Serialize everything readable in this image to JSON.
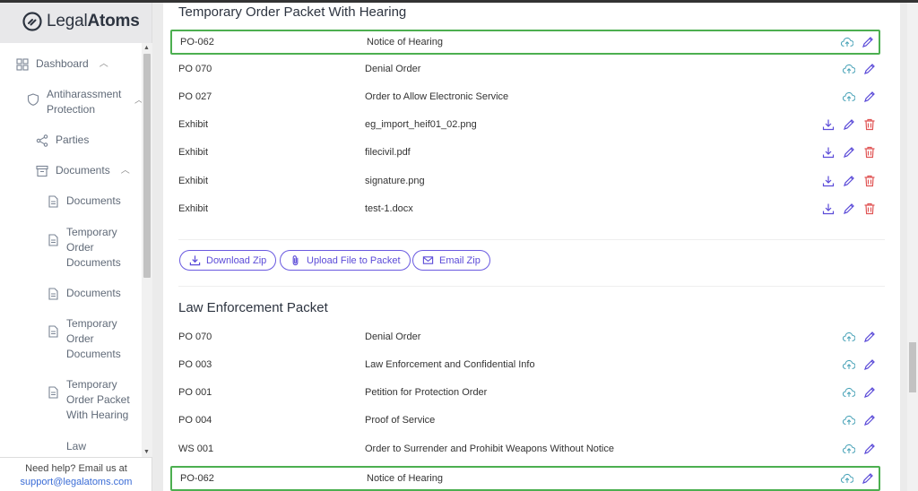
{
  "brand": {
    "name_light": "Legal",
    "name_bold": "Atoms"
  },
  "sidebar": {
    "items": [
      {
        "label": "Dashboard",
        "icon": "grid-icon"
      },
      {
        "label": "Antiharassment Protection",
        "icon": "shield-icon"
      },
      {
        "label": "Parties",
        "icon": "share-icon"
      },
      {
        "label": "Documents",
        "icon": "archive-icon"
      },
      {
        "label": "Documents",
        "icon": "file-icon"
      },
      {
        "label": "Temporary Order Documents",
        "icon": "file-icon"
      },
      {
        "label": "Documents",
        "icon": "file-icon"
      },
      {
        "label": "Temporary Order Documents",
        "icon": "file-icon"
      },
      {
        "label": "Temporary Order Packet With Hearing",
        "icon": "file-icon"
      },
      {
        "label": "Law",
        "icon": "file-icon"
      }
    ],
    "help_text": "Need help? Email us at",
    "help_email": "support@legalatoms.com"
  },
  "packet1": {
    "title": "Temporary Order Packet With Hearing",
    "rows": [
      {
        "code": "PO-062",
        "name": "Notice of Hearing",
        "actions": [
          "upload-cloud-icon",
          "edit-pencil-icon"
        ]
      },
      {
        "code": "PO 070",
        "name": "Denial Order",
        "actions": [
          "upload-cloud-icon",
          "edit-pencil-icon"
        ]
      },
      {
        "code": "PO 027",
        "name": "Order to Allow Electronic Service",
        "actions": [
          "upload-cloud-icon",
          "edit-pencil-icon"
        ]
      },
      {
        "code": "Exhibit",
        "name": "eg_import_heif01_02.png",
        "actions": [
          "download-icon",
          "edit-pencil-icon",
          "trash-icon"
        ]
      },
      {
        "code": "Exhibit",
        "name": "filecivil.pdf",
        "actions": [
          "download-icon",
          "edit-pencil-icon",
          "trash-icon"
        ]
      },
      {
        "code": "Exhibit",
        "name": "signature.png",
        "actions": [
          "download-icon",
          "edit-pencil-icon",
          "trash-icon"
        ]
      },
      {
        "code": "Exhibit",
        "name": "test-1.docx",
        "actions": [
          "download-icon",
          "edit-pencil-icon",
          "trash-icon"
        ]
      }
    ],
    "buttons": {
      "download_zip": "Download Zip",
      "upload_file": "Upload File to Packet",
      "email_zip": "Email Zip"
    }
  },
  "packet2": {
    "title": "Law Enforcement Packet",
    "rows": [
      {
        "code": "PO 070",
        "name": "Denial Order"
      },
      {
        "code": "PO 003",
        "name": "Law Enforcement and Confidential Info"
      },
      {
        "code": "PO 001",
        "name": "Petition for Protection Order"
      },
      {
        "code": "PO 004",
        "name": "Proof of Service"
      },
      {
        "code": "WS 001",
        "name": "Order to Surrender and Prohibit Weapons Without Notice"
      },
      {
        "code": "PO-062",
        "name": "Notice of Hearing"
      }
    ]
  },
  "colors": {
    "accent": "#5b4bd8",
    "upload": "#4aa3b8",
    "trash": "#e05555",
    "highlight": "#4caf50"
  }
}
